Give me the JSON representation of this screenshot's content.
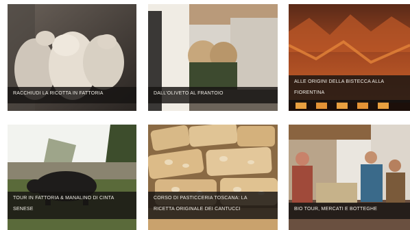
{
  "tours": [
    {
      "caption": "RACCHIUDI LA RICOTTA IN FATTORIA",
      "image": "sheep-photo"
    },
    {
      "caption": "DALL'OLIVETO AL FRANTOIO",
      "image": "olive-mill-photo"
    },
    {
      "caption_lines": [
        "ALLE ORIGINI DELLA BISTECCA ALLA",
        "FIORENTINA"
      ],
      "image": "steak-grill-photo"
    },
    {
      "caption_lines": [
        "TOUR IN FATTORIA & MANALINO DI CINTA",
        "SENESE"
      ],
      "image": "pig-farm-photo"
    },
    {
      "caption_lines": [
        "CORSO DI PASTICCERIA TOSCANA: LA",
        "RICETTA ORIGINALE DEI CANTUCCI"
      ],
      "image": "cantucci-photo"
    },
    {
      "caption": "BIO TOUR, MERCATI E BOTTEGHE",
      "image": "market-photo"
    }
  ]
}
